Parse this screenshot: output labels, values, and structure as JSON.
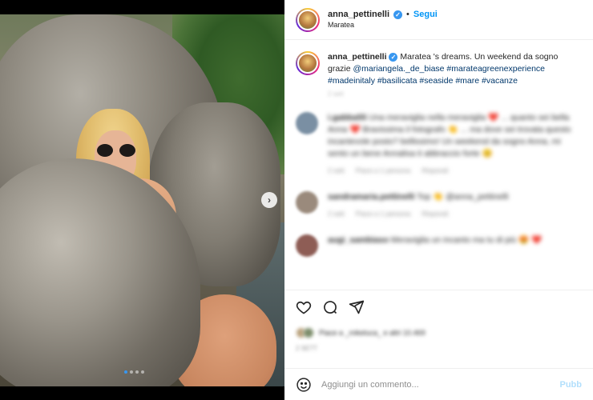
{
  "header": {
    "username": "anna_pettinelli",
    "separator": "•",
    "follow_label": "Segui",
    "location": "Maratea"
  },
  "caption": {
    "username": "anna_pettinelli",
    "text_start": "Maratea 's dreams. Un weekend da sogno grazie ",
    "mention": "@mariangela._de_biase",
    "hashtags": "#marateagreenexperience #madeinitaly #basilicata #seaside #mare #vacanze",
    "time": "2 sett"
  },
  "comments": [
    {
      "username": "i.gabba55",
      "text": "Una meraviglia nella meraviglia ❤️ ... quanto sei bella Anna ❤️ Bravissima il fotografo 👏 ... ma dove sei trovata questo incantevole posto? bellissimo! Un weekend da sogno Anna, mi sento un bene Annalisa ti abbraccio forte 😊",
      "time": "2 sett",
      "likes": "Piace a 1 persona",
      "reply": "Rispondi",
      "avatar_color": "#7a8fa3"
    },
    {
      "username": "sandramaria.pettinelli",
      "text": "Top 👏 @anna_pettinelli",
      "time": "2 sett",
      "likes": "Piace a 1 persona",
      "reply": "Rispondi",
      "avatar_color": "#9a8a7c"
    },
    {
      "username": "augi_sambiaso",
      "text": "Meraviglia un incanto ma tu di più 😍 ❤️",
      "time": "",
      "likes": "",
      "reply": "",
      "avatar_color": "#8e5d55"
    }
  ],
  "actions": {
    "like_icon": "heart-icon",
    "comment_icon": "comment-icon",
    "share_icon": "share-icon",
    "liked_by": "Piace a _mikeluca_ e altri 10.469",
    "date": "2 SETT"
  },
  "add_comment": {
    "placeholder": "Aggiungi un commento...",
    "publish_label": "Pubb"
  },
  "colors": {
    "accent": "#0095f6",
    "verified": "#3897f0",
    "link": "#00376b",
    "publish_disabled": "#b2dffc"
  }
}
